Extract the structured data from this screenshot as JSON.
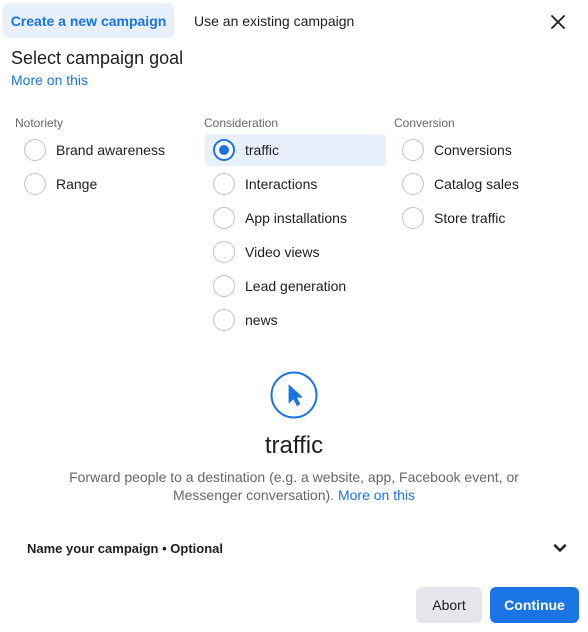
{
  "tabs": {
    "create": "Create a new campaign",
    "existing": "Use an existing campaign"
  },
  "header": {
    "title": "Select campaign goal",
    "more_link": "More on this"
  },
  "columns": [
    {
      "heading": "Notoriety",
      "options": [
        "Brand awareness",
        "Range"
      ]
    },
    {
      "heading": "Consideration",
      "options": [
        "traffic",
        "Interactions",
        "App installations",
        "Video views",
        "Lead generation",
        "news"
      ]
    },
    {
      "heading": "Conversion",
      "options": [
        "Conversions",
        "Catalog sales",
        "Store traffic"
      ]
    }
  ],
  "selected_option": "traffic",
  "goal": {
    "icon": "cursor-pointer-icon",
    "title": "traffic",
    "description": "Forward people to a destination (e.g. a website, app, Facebook event, or Messenger conversation).",
    "more_link": "More on this"
  },
  "name_section": {
    "label": "Name your campaign • Optional"
  },
  "buttons": {
    "abort": "Abort",
    "continue": "Continue"
  },
  "colors": {
    "accent": "#1b74e4",
    "selected_bg": "#e7f0fb"
  }
}
